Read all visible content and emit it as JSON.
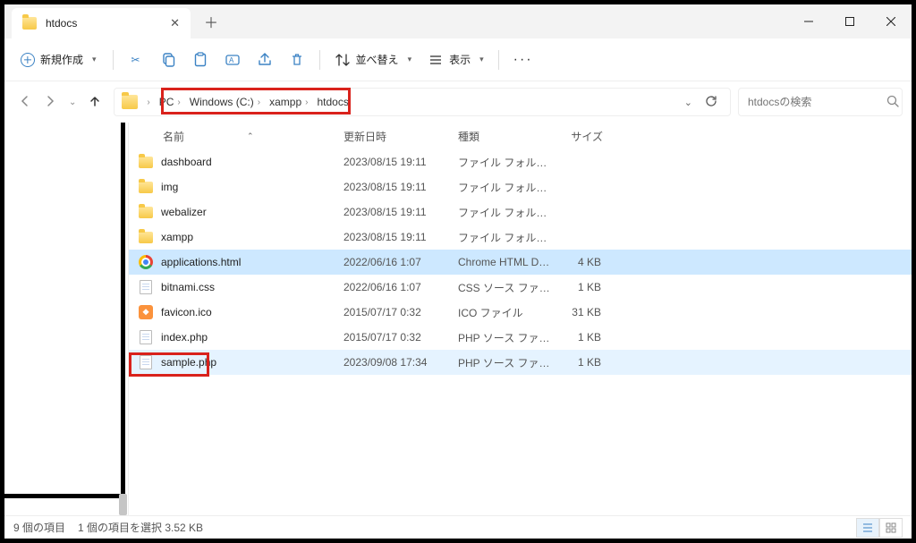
{
  "tab": {
    "title": "htdocs"
  },
  "toolbar": {
    "new_label": "新規作成",
    "sort_label": "並べ替え",
    "view_label": "表示"
  },
  "breadcrumb": {
    "items": [
      "PC",
      "Windows (C:)",
      "xampp",
      "htdocs"
    ]
  },
  "search": {
    "placeholder": "htdocsの検索"
  },
  "columns": {
    "name": "名前",
    "date": "更新日時",
    "type": "種類",
    "size": "サイズ"
  },
  "files": [
    {
      "name": "dashboard",
      "date": "2023/08/15 19:11",
      "type": "ファイル フォルダー",
      "size": "",
      "icon": "folder"
    },
    {
      "name": "img",
      "date": "2023/08/15 19:11",
      "type": "ファイル フォルダー",
      "size": "",
      "icon": "folder"
    },
    {
      "name": "webalizer",
      "date": "2023/08/15 19:11",
      "type": "ファイル フォルダー",
      "size": "",
      "icon": "folder"
    },
    {
      "name": "xampp",
      "date": "2023/08/15 19:11",
      "type": "ファイル フォルダー",
      "size": "",
      "icon": "folder"
    },
    {
      "name": "applications.html",
      "date": "2022/06/16 1:07",
      "type": "Chrome HTML Do...",
      "size": "4 KB",
      "icon": "chrome",
      "selected": true
    },
    {
      "name": "bitnami.css",
      "date": "2022/06/16 1:07",
      "type": "CSS ソース ファイル",
      "size": "1 KB",
      "icon": "generic"
    },
    {
      "name": "favicon.ico",
      "date": "2015/07/17 0:32",
      "type": "ICO ファイル",
      "size": "31 KB",
      "icon": "ico"
    },
    {
      "name": "index.php",
      "date": "2015/07/17 0:32",
      "type": "PHP ソース ファイル",
      "size": "1 KB",
      "icon": "generic"
    },
    {
      "name": "sample.php",
      "date": "2023/09/08 17:34",
      "type": "PHP ソース ファイル",
      "size": "1 KB",
      "icon": "generic",
      "highlight": true
    }
  ],
  "status": {
    "count": "9 個の項目",
    "selected": "1 個の項目を選択 3.52 KB"
  }
}
